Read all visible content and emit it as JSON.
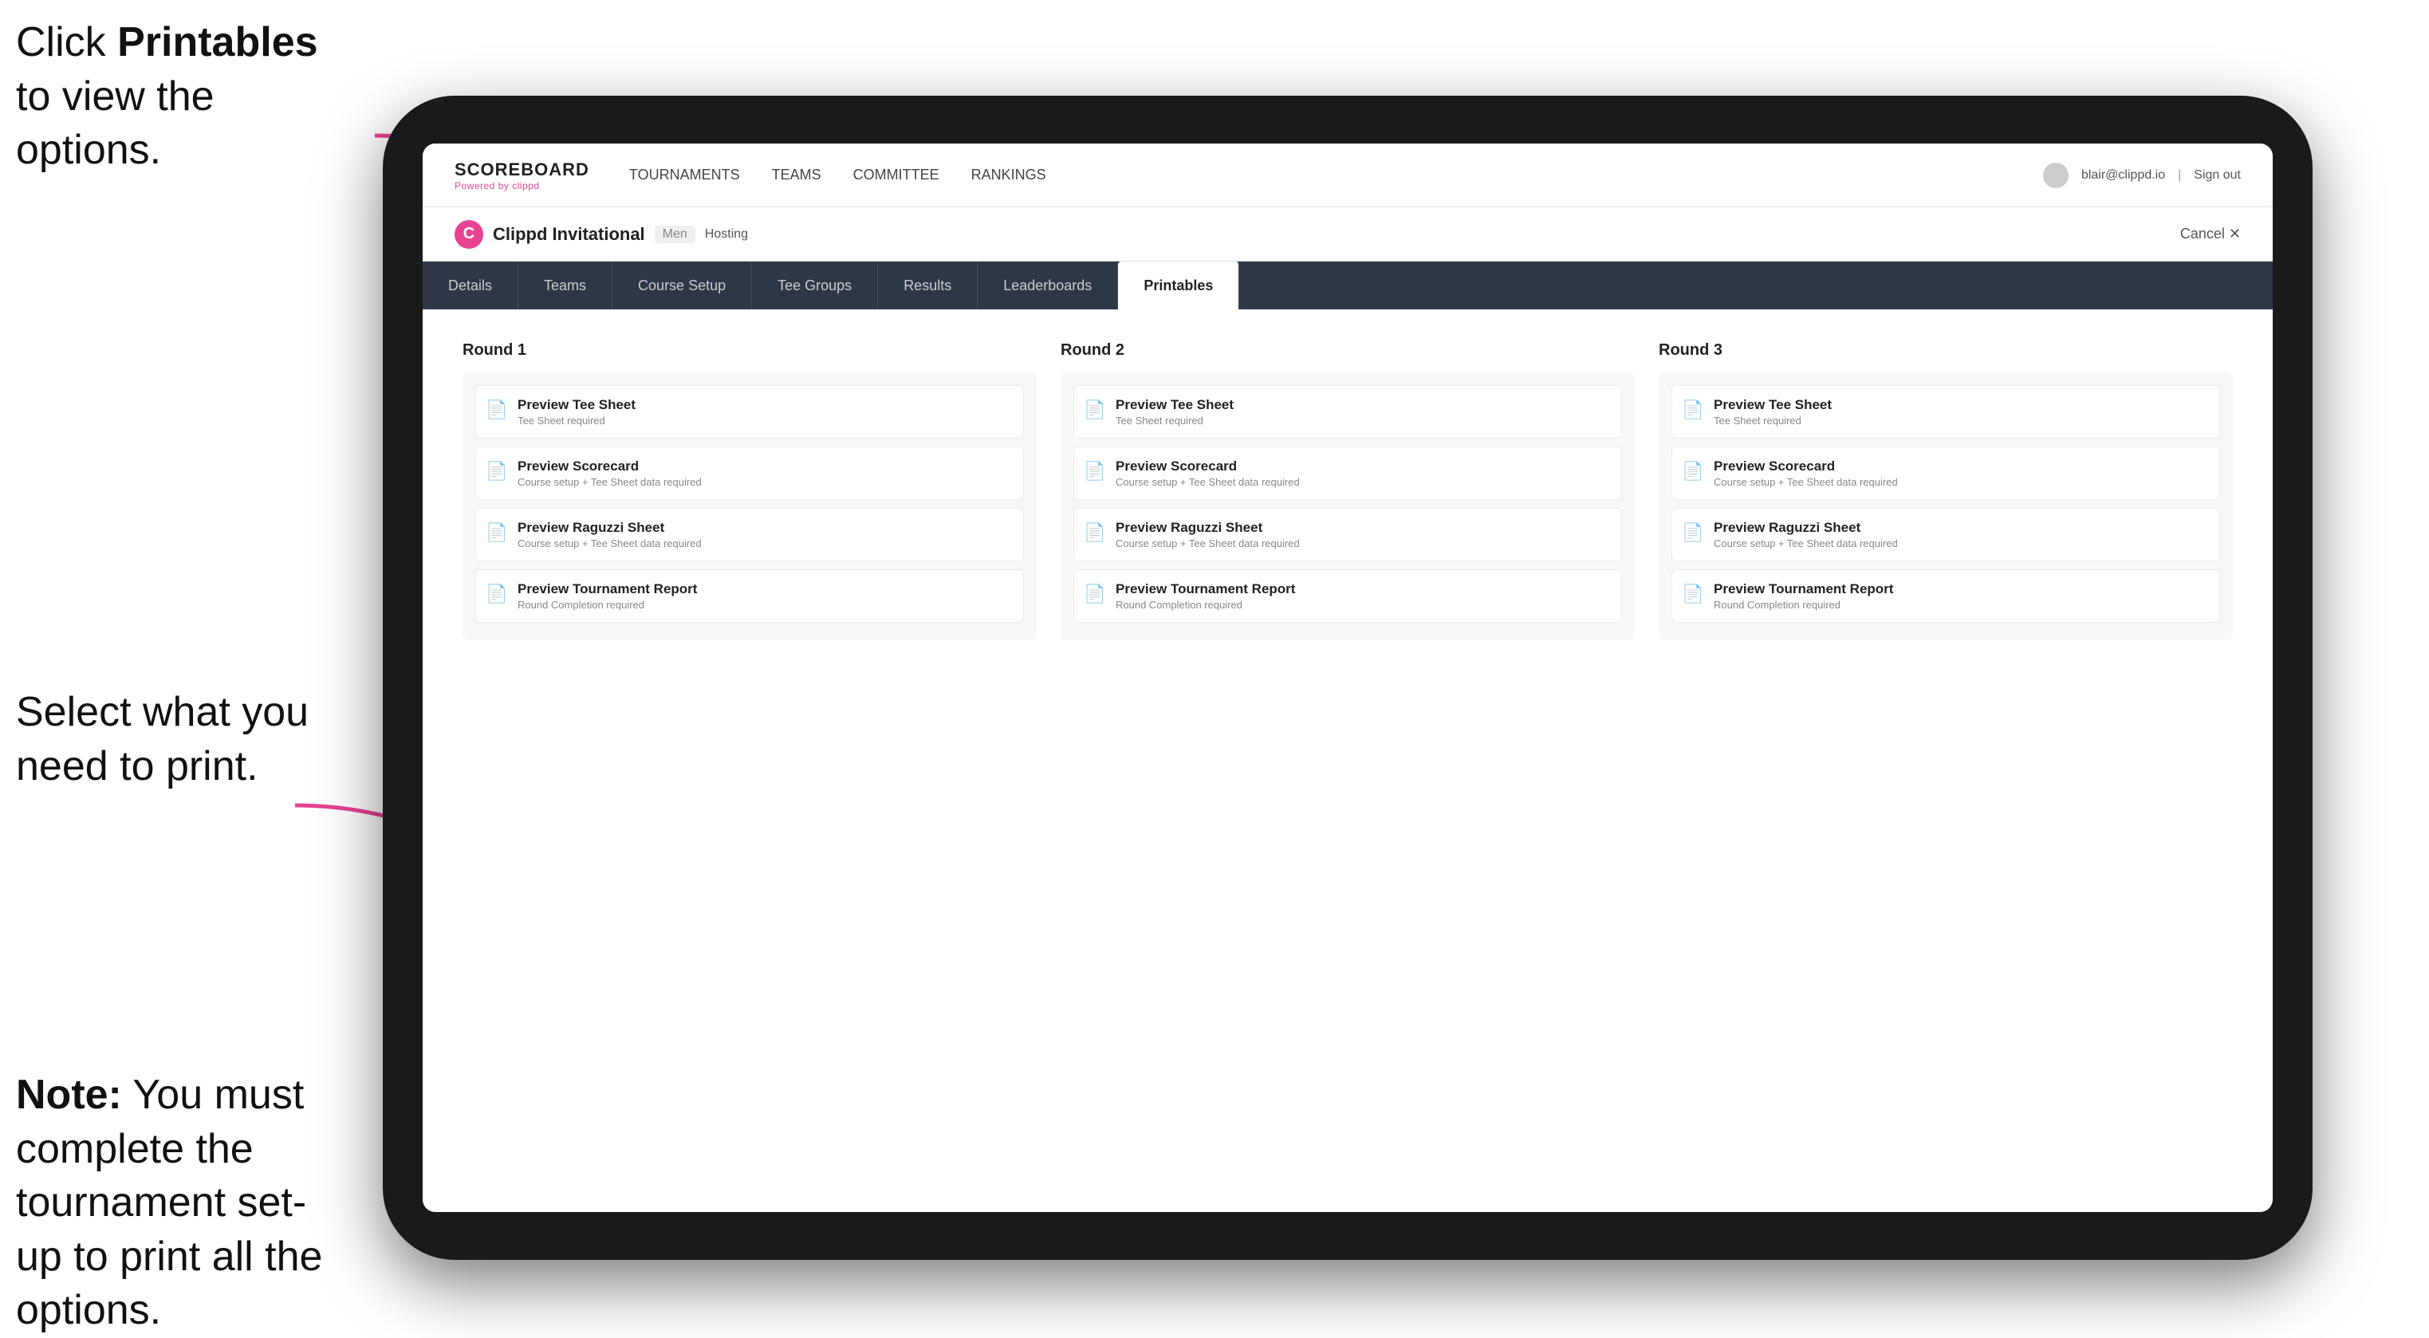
{
  "annotations": {
    "top": {
      "prefix": "Click ",
      "bold": "Printables",
      "suffix": " to view the options."
    },
    "middle": {
      "text": "Select what you need to print."
    },
    "bottom": {
      "bold": "Note:",
      "text": " You must complete the tournament set-up to print all the options."
    }
  },
  "topnav": {
    "logo": "SCOREBOARD",
    "logo_sub": "Powered by clippd",
    "links": [
      "TOURNAMENTS",
      "TEAMS",
      "COMMITTEE",
      "RANKINGS"
    ],
    "user_email": "blair@clippd.io",
    "sign_out": "Sign out"
  },
  "tournament": {
    "logo_letter": "C",
    "name": "Clippd Invitational",
    "badge": "Men",
    "status": "Hosting",
    "cancel": "Cancel ✕"
  },
  "tabs": [
    "Details",
    "Teams",
    "Course Setup",
    "Tee Groups",
    "Results",
    "Leaderboards",
    "Printables"
  ],
  "active_tab": "Printables",
  "rounds": [
    {
      "label": "Round 1",
      "cards": [
        {
          "title": "Preview Tee Sheet",
          "subtitle": "Tee Sheet required"
        },
        {
          "title": "Preview Scorecard",
          "subtitle": "Course setup + Tee Sheet data required"
        },
        {
          "title": "Preview Raguzzi Sheet",
          "subtitle": "Course setup + Tee Sheet data required"
        },
        {
          "title": "Preview Tournament Report",
          "subtitle": "Round Completion required"
        }
      ]
    },
    {
      "label": "Round 2",
      "cards": [
        {
          "title": "Preview Tee Sheet",
          "subtitle": "Tee Sheet required"
        },
        {
          "title": "Preview Scorecard",
          "subtitle": "Course setup + Tee Sheet data required"
        },
        {
          "title": "Preview Raguzzi Sheet",
          "subtitle": "Course setup + Tee Sheet data required"
        },
        {
          "title": "Preview Tournament Report",
          "subtitle": "Round Completion required"
        }
      ]
    },
    {
      "label": "Round 3",
      "cards": [
        {
          "title": "Preview Tee Sheet",
          "subtitle": "Tee Sheet required"
        },
        {
          "title": "Preview Scorecard",
          "subtitle": "Course setup + Tee Sheet data required"
        },
        {
          "title": "Preview Raguzzi Sheet",
          "subtitle": "Course setup + Tee Sheet data required"
        },
        {
          "title": "Preview Tournament Report",
          "subtitle": "Round Completion required"
        }
      ]
    }
  ],
  "colors": {
    "accent": "#e84393",
    "nav_bg": "#2d3748",
    "active_tab_bg": "#ffffff"
  }
}
